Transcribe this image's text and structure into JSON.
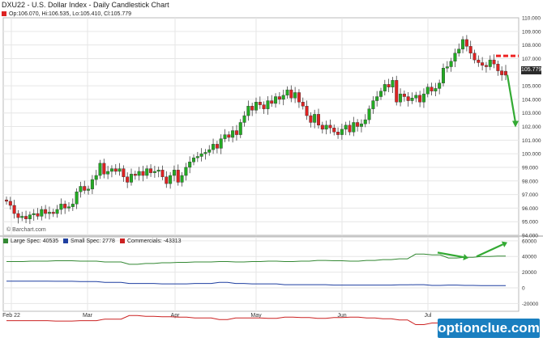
{
  "title": "DXU22 - U.S. Dollar Index - Daily Candlestick Chart",
  "ohlc_header": "Op:106.070, Hi:106.535, Lo:105.410, Cl:105.779",
  "last_price_label": "105.779",
  "credit": "© Barchart.com",
  "logo": "optionclue.com",
  "colors": {
    "up": "#22aa22",
    "down": "#dd2222",
    "large_spec": "#338833",
    "small_spec": "#1f3fa0",
    "commercials": "#cc2222",
    "arrow": "#33aa33",
    "dash": "#ee2222"
  },
  "legend": {
    "large_spec": "Large Spec: 40535",
    "small_spec": "Small Spec: 2778",
    "commercials": "Commercials: -43313"
  },
  "chart_data": [
    {
      "type": "candlestick",
      "x_labels": [
        "Feb 22",
        "Mar",
        "Apr",
        "May",
        "Jun",
        "Jul"
      ],
      "y_ticks": [
        94.0,
        95.0,
        96.0,
        97.0,
        98.0,
        99.0,
        100.0,
        101.0,
        102.0,
        103.0,
        104.0,
        105.0,
        106.0,
        107.0,
        108.0,
        109.0,
        110.0
      ],
      "ylim": [
        94.0,
        110.0
      ],
      "grid": true,
      "closes": [
        96.5,
        96.2,
        95.6,
        95.3,
        95.4,
        95.2,
        95.5,
        95.6,
        95.4,
        95.9,
        95.6,
        95.7,
        95.6,
        95.9,
        96.3,
        96.0,
        96.1,
        96.3,
        97.2,
        97.6,
        97.3,
        97.4,
        98.1,
        98.4,
        99.3,
        98.5,
        98.7,
        98.9,
        98.7,
        98.9,
        98.3,
        97.9,
        98.5,
        98.4,
        98.7,
        98.4,
        98.9,
        98.6,
        98.7,
        98.8,
        98.3,
        97.8,
        98.4,
        98.8,
        97.9,
        98.4,
        99.0,
        99.4,
        99.7,
        99.8,
        100.0,
        100.1,
        100.3,
        100.7,
        100.4,
        101.1,
        101.4,
        101.2,
        101.7,
        101.4,
        102.3,
        102.8,
        103.5,
        103.2,
        103.8,
        103.6,
        103.3,
        103.9,
        103.7,
        104.2,
        104.0,
        104.3,
        104.7,
        104.1,
        104.5,
        103.8,
        103.5,
        102.8,
        102.3,
        102.9,
        102.1,
        101.8,
        102.1,
        101.9,
        101.6,
        101.4,
        101.8,
        102.1,
        101.6,
        102.3,
        102.0,
        102.2,
        102.5,
        103.3,
        103.9,
        104.2,
        104.6,
        105.1,
        104.9,
        105.4,
        103.8,
        104.4,
        104.2,
        103.9,
        104.1,
        104.3,
        103.8,
        104.4,
        104.9,
        104.6,
        104.8,
        105.2,
        106.3,
        106.4,
        106.8,
        107.4,
        107.7,
        108.4,
        107.9,
        107.4,
        106.9,
        106.7,
        106.5,
        106.4,
        106.9,
        106.6,
        106.1,
        105.8
      ],
      "opens": [
        96.6,
        96.5,
        96.2,
        95.6,
        95.3,
        95.4,
        95.2,
        95.5,
        95.6,
        95.4,
        95.9,
        95.6,
        95.7,
        95.6,
        95.9,
        96.3,
        96.0,
        96.1,
        96.3,
        97.2,
        97.6,
        97.3,
        97.4,
        98.1,
        98.4,
        99.3,
        98.5,
        98.7,
        98.9,
        98.7,
        98.9,
        98.3,
        97.9,
        98.5,
        98.4,
        98.7,
        98.4,
        98.9,
        98.6,
        98.7,
        98.8,
        98.3,
        97.8,
        98.4,
        98.8,
        97.9,
        98.4,
        99.0,
        99.4,
        99.7,
        99.8,
        100.0,
        100.1,
        100.3,
        100.7,
        100.4,
        101.1,
        101.4,
        101.2,
        101.7,
        101.4,
        102.3,
        102.8,
        103.5,
        103.2,
        103.8,
        103.6,
        103.3,
        103.9,
        103.7,
        104.2,
        104.0,
        104.3,
        104.7,
        104.1,
        104.5,
        103.8,
        103.5,
        102.8,
        102.3,
        102.9,
        102.1,
        101.8,
        102.1,
        101.9,
        101.6,
        101.4,
        101.8,
        102.1,
        101.6,
        102.3,
        102.0,
        102.2,
        102.5,
        103.3,
        103.9,
        104.2,
        104.6,
        105.1,
        104.9,
        105.4,
        103.8,
        104.4,
        104.2,
        103.9,
        104.1,
        104.3,
        103.8,
        104.4,
        104.9,
        104.6,
        104.8,
        105.2,
        106.3,
        106.4,
        106.8,
        107.4,
        107.7,
        108.4,
        107.9,
        107.4,
        106.9,
        106.7,
        106.5,
        106.4,
        106.9,
        106.6,
        106.1
      ],
      "last_open": 106.07,
      "last_high": 106.535,
      "last_low": 105.41,
      "last_close": 105.779,
      "dashed_level": 107.2,
      "annotation": {
        "type": "arrow",
        "from": 105.8,
        "to": 102.0
      }
    },
    {
      "type": "line",
      "y_ticks": [
        -20000,
        0,
        20000,
        40000,
        60000
      ],
      "ylim": [
        -30000,
        65000
      ],
      "grid": true,
      "series": [
        {
          "name": "Large Spec",
          "values": [
            33500,
            33500,
            33500,
            34000,
            34000,
            34000,
            34500,
            34500,
            34500,
            34000,
            34000,
            34000,
            33000,
            33000,
            33000,
            30000,
            30000,
            31000,
            31000,
            32000,
            32000,
            32500,
            32500,
            33000,
            33000,
            33000,
            33500,
            33500,
            33000,
            33000,
            33500,
            33500,
            34000,
            34000,
            33500,
            33500,
            34000,
            34000,
            35000,
            35000,
            34500,
            34500,
            34000,
            34000,
            35000,
            35000,
            36000,
            36000,
            37000,
            37000,
            43000,
            43000,
            42000,
            42000,
            38000,
            38000,
            39000,
            39000,
            40000,
            40000,
            40535,
            40535
          ]
        },
        {
          "name": "Small Spec",
          "values": [
            8500,
            8500,
            8500,
            8500,
            8500,
            8500,
            8300,
            8300,
            8300,
            8000,
            8000,
            8000,
            7000,
            7000,
            7000,
            5500,
            5500,
            5500,
            5500,
            5000,
            5000,
            5000,
            5000,
            5500,
            5500,
            5500,
            7000,
            7000,
            5500,
            5500,
            5000,
            5000,
            5000,
            5000,
            4000,
            4000,
            4000,
            4000,
            4000,
            4000,
            3500,
            3500,
            3500,
            3500,
            3500,
            3500,
            3500,
            3500,
            3800,
            3800,
            4000,
            4000,
            3000,
            3000,
            3500,
            3500,
            3000,
            3000,
            2800,
            2800,
            2778,
            2778
          ]
        },
        {
          "name": "Commercials",
          "values": [
            -42000,
            -42000,
            -42000,
            -42000,
            -42000,
            -42000,
            -42500,
            -42500,
            -42500,
            -42000,
            -42000,
            -42000,
            -40000,
            -40000,
            -40000,
            -35500,
            -35500,
            -36500,
            -36500,
            -37000,
            -37000,
            -37500,
            -37500,
            -38500,
            -38500,
            -38500,
            -40500,
            -40500,
            -38500,
            -38500,
            -38500,
            -38500,
            -39000,
            -39000,
            -37500,
            -37500,
            -38000,
            -38000,
            -39000,
            -39000,
            -38000,
            -38000,
            -37500,
            -37500,
            -38500,
            -38500,
            -39500,
            -39500,
            -41000,
            -41000,
            -47000,
            -47000,
            -45000,
            -45000,
            -41500,
            -41500,
            -42000,
            -42000,
            -42800,
            -42800,
            -43313,
            -43313
          ]
        }
      ],
      "annotation": [
        {
          "type": "arrow",
          "from": 45000,
          "to": 38000
        },
        {
          "type": "arrow",
          "from": 40000,
          "to": 58000
        }
      ]
    }
  ]
}
